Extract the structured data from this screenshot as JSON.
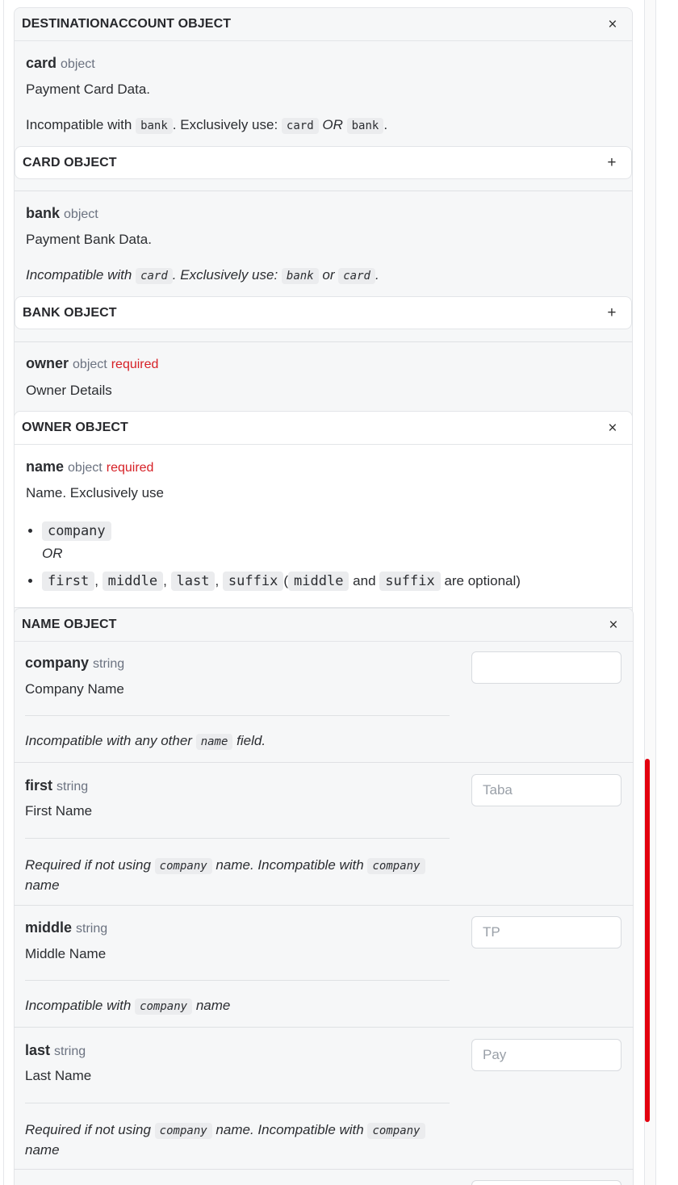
{
  "destination": {
    "header": "DESTINATIONACCOUNT OBJECT",
    "header_icon": "close-icon"
  },
  "card": {
    "name": "card",
    "type": "object",
    "description": "Payment Card Data.",
    "note_prefix": "Incompatible with",
    "note_code1": "bank",
    "note_mid": ". Exclusively use:",
    "note_code2": "card",
    "note_or": "OR",
    "note_code3": "bank",
    "note_end": ".",
    "object_header": "CARD OBJECT",
    "object_icon": "plus-icon"
  },
  "bank": {
    "name": "bank",
    "type": "object",
    "description": "Payment Bank Data.",
    "note_prefix": "Incompatible with",
    "note_code1": "card",
    "note_mid": ". Exclusively use:",
    "note_code2": "bank",
    "note_or": "or",
    "note_code3": "card",
    "note_end": ".",
    "object_header": "BANK OBJECT",
    "object_icon": "plus-icon"
  },
  "owner": {
    "name": "owner",
    "type": "object",
    "required": "required",
    "description": "Owner Details",
    "object_header": "OWNER OBJECT",
    "object_icon": "close-icon"
  },
  "name_prop": {
    "name": "name",
    "type": "object",
    "required": "required",
    "description": "Name. Exclusively use",
    "option1_code": "company",
    "option1_or": "OR",
    "option2_codes": [
      "first",
      "middle",
      "last",
      "suffix"
    ],
    "option2_paren_code1": "middle",
    "option2_and": "and",
    "option2_paren_code2": "suffix",
    "option2_tail": "are optional)",
    "object_header": "NAME OBJECT",
    "object_icon": "close-icon"
  },
  "fields": [
    {
      "name": "company",
      "type": "string",
      "description": "Company Name",
      "value": "",
      "placeholder": "",
      "note": "Incompatible with any other",
      "note_code": "name",
      "note_end": "field."
    },
    {
      "name": "first",
      "type": "string",
      "description": "First Name",
      "value": "",
      "placeholder": "Taba",
      "note": "Required if not using",
      "note_code": "company",
      "note_mid": "name. Incompatible with",
      "note_code2": "company",
      "note_end": "name"
    },
    {
      "name": "middle",
      "type": "string",
      "description": "Middle Name",
      "value": "",
      "placeholder": "TP",
      "note": "Incompatible with",
      "note_code": "company",
      "note_end": "name"
    },
    {
      "name": "last",
      "type": "string",
      "description": "Last Name",
      "value": "",
      "placeholder": "Pay",
      "note": "Required if not using",
      "note_code": "company",
      "note_mid": "name. Incompatible with",
      "note_code2": "company",
      "note_end": "name"
    }
  ],
  "colors": {
    "required": "#d61f25",
    "scroll_indicator": "#e3000f",
    "panel_bg": "#f6f7f8"
  }
}
